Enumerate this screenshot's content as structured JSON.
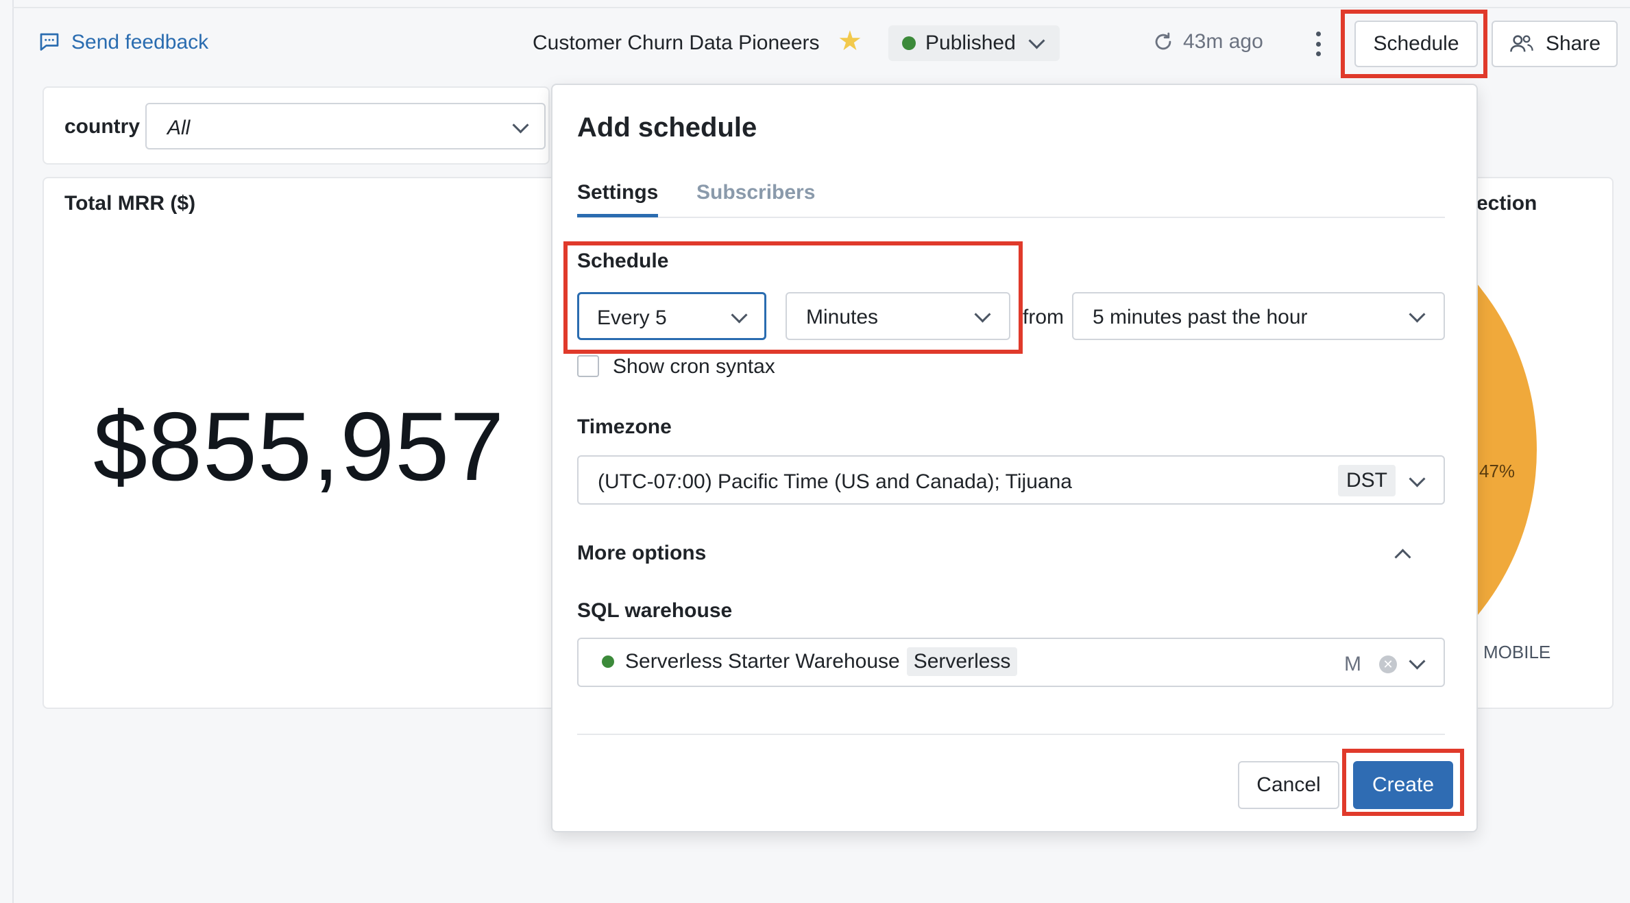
{
  "header": {
    "feedback_label": "Send feedback",
    "dashboard_title": "Customer Churn Data Pioneers",
    "status_label": "Published",
    "refresh_label": "43m ago",
    "schedule_button": "Schedule",
    "share_button": "Share"
  },
  "filter": {
    "label": "country",
    "value": "All"
  },
  "mrr_card": {
    "title": "Total MRR ($)",
    "value": "$855,957"
  },
  "pie_card": {
    "title_partial": "ection",
    "slice_label": "47%",
    "legend_label": "MOBILE",
    "slice_color": "#f0a93b"
  },
  "modal": {
    "title": "Add schedule",
    "tabs": [
      "Settings",
      "Subscribers"
    ],
    "active_tab": "Settings",
    "schedule_label": "Schedule",
    "interval_value": "Every 5",
    "unit_value": "Minutes",
    "from_label": "from",
    "offset_value": "5 minutes past the hour",
    "cron_label": "Show cron syntax",
    "cron_checked": false,
    "timezone_label": "Timezone",
    "timezone_value": "(UTC-07:00) Pacific Time (US and Canada); Tijuana",
    "dst_badge": "DST",
    "more_options_label": "More options",
    "warehouse_label": "SQL warehouse",
    "warehouse_name": "Serverless Starter Warehouse",
    "warehouse_type": "Serverless",
    "warehouse_size": "M",
    "cancel_button": "Cancel",
    "create_button": "Create"
  },
  "colors": {
    "accent": "#2f6cb3",
    "highlight": "#e03a2b",
    "status_green": "#3c8a3a",
    "star": "#f2c94c"
  }
}
